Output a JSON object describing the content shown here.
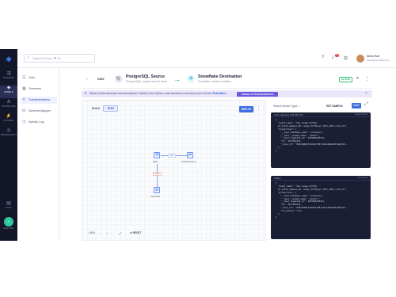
{
  "rail": {
    "items": [
      {
        "label": "PIPELINES",
        "icon": "pipeline-icon"
      },
      {
        "label": "MODELS",
        "icon": "models-icon"
      },
      {
        "label": "WORKFLOWS",
        "icon": "workflow-icon"
      },
      {
        "label": "ACTIVATE",
        "icon": "activate-icon"
      },
      {
        "label": "OBSERVABILITY",
        "icon": "observability-icon"
      },
      {
        "label": "DOCS",
        "icon": "docs-icon"
      }
    ],
    "bottom_label": "LIVE CHAT"
  },
  "topbar": {
    "search_placeholder": "Search (Press   ⌘ K)",
    "user_name": "Alexa Rae",
    "user_email": "alexa@hevodata.com",
    "notif_count": "9"
  },
  "subnav": {
    "items": [
      {
        "label": "Jobs",
        "icon": "jobs-icon"
      },
      {
        "label": "Overview",
        "icon": "overview-icon"
      },
      {
        "label": "Transformations",
        "icon": "transform-icon"
      },
      {
        "label": "Schema Mapper",
        "icon": "schema-icon"
      },
      {
        "label": "Activity Log",
        "icon": "log-icon"
      }
    ],
    "active_index": 2
  },
  "pipeline": {
    "id": "#367",
    "source_name": "PostgreSQL Source",
    "source_sub": "Pricing-V6(2) • Ingests every 2 hours",
    "dest_name": "Snowflake Destination",
    "dest_sub": "Snowflake • Loads in realtime",
    "status": "ACTIVE"
  },
  "banner": {
    "text_prefix": "Want to build advanced transformations? Switch to the Python code interface to transform your Events.",
    "link": "Read More",
    "button": "ENABLE PYTHON INTERFACE"
  },
  "canvas": {
    "mode_build": "BUILD",
    "mode_test": "TEST",
    "deploy": "DEPLOY",
    "zoom": "100%",
    "reset": "RESET",
    "nodes": [
      {
        "label": "Filter"
      },
      {
        "label": "Field Rename"
      },
      {
        "label": "Add Field"
      }
    ],
    "edge_true": "True",
    "edge_false": "False"
  },
  "events": {
    "select_label": "Select Event Type",
    "get_sample": "GET SAMPLE",
    "test": "TEST",
    "input_title": "Input • Event at 1:56 PM UTC",
    "input_right": "Sample Event",
    "output_title": "Output",
    "output_right": "Test Result",
    "input_lines": [
      "{",
      "  \"event_name\": \"dev-range-157784-",
      "  pf_state_demand_dmr_range_157784_pf_1673_a384_cl41_att\",",
      "  \"properties\": {",
      "    \"__hevo_database_name\": \"postgres\",",
      "    \"__hevo__schema_name\": \"public\",",
      "    \"__hevo_ingested_at\": 1679985470321,",
      "    \"id\": 1017484743,",
      "    \"_hevo_id\": \"00a5e00b157e6211f907c4b1a18eb1813ab8c90...",
      "  }",
      "}"
    ],
    "output_lines": [
      "{",
      "  \"event_name\": \"dev-range-157784-",
      "  pf_state_demand_dmr_range_157784_pf_1673_a384_cl41_att\",",
      "  \"properties\": {",
      "    \"__hevo_database_name\": \"postgres\",",
      "    \"__hevo__schema_name\": \"public\",",
      "    \"__hevo_ingested_at\": 1679985470321,",
      "    \"id\": 1017484743,",
      "    \"_hevo_id\": \"00a5e00b157e6211f907c4b1a18eb1813ab8c90...",
      "    \"is_active\": true",
      "  }",
      "}"
    ]
  },
  "colors": {
    "rail_bg": "#14172a",
    "accent": "#3f6fe0",
    "active_green": "#2fbf71",
    "banner_bg": "#ebe7fb",
    "code_bg": "#1b1f36"
  }
}
